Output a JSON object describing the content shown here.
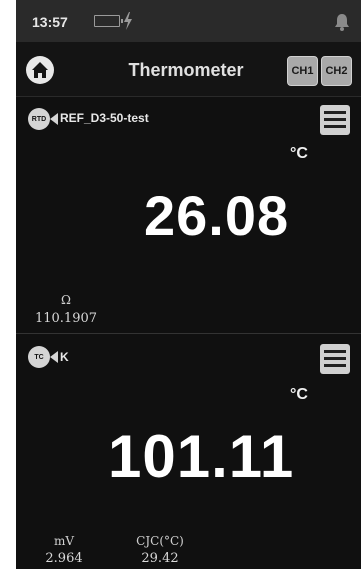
{
  "status": {
    "time": "13:57"
  },
  "header": {
    "title": "Thermometer",
    "ch1_label": "CH1",
    "ch2_label": "CH2"
  },
  "channel1": {
    "sensor_badge": "RTD",
    "sensor_name": "REF_D3-50-test",
    "unit": "°C",
    "value": "26.08",
    "aux": [
      {
        "label": "Ω",
        "value": "110.1907"
      }
    ]
  },
  "channel2": {
    "sensor_badge": "TC",
    "sensor_name": "K",
    "unit": "°C",
    "value": "101.11",
    "aux": [
      {
        "label": "mV",
        "value": "2.964"
      },
      {
        "label": "CJC(°C)",
        "value": "29.42"
      }
    ]
  },
  "icons": {
    "home": "home-icon",
    "menu": "hamburger-menu-icon",
    "battery": "battery-icon",
    "charging": "lightning-bolt-icon",
    "bell": "bell-icon"
  },
  "colors": {
    "background": "#101010",
    "statusbar": "#2a2a2a",
    "button": "#a9a9a9",
    "text": "#ffffff"
  }
}
